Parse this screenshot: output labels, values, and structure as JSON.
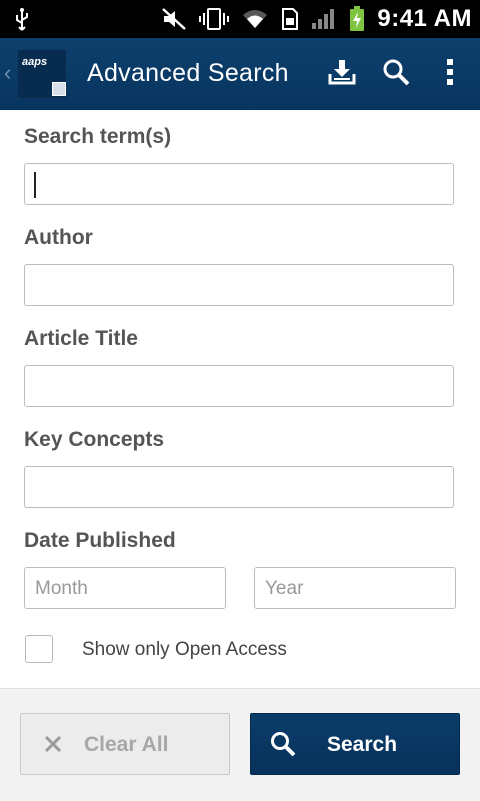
{
  "status_bar": {
    "time": "9:41 AM",
    "icons": [
      "usb-icon",
      "mute-icon",
      "vibrate-icon",
      "wifi-icon",
      "sim-icon",
      "signal-icon",
      "battery-charging-icon"
    ]
  },
  "action_bar": {
    "title": "Advanced Search",
    "logo_text": "aaps",
    "actions": [
      "download-icon",
      "search-icon",
      "overflow-menu-icon"
    ]
  },
  "form": {
    "search_terms": {
      "label": "Search term(s)",
      "value": ""
    },
    "author": {
      "label": "Author",
      "value": ""
    },
    "article_title": {
      "label": "Article Title",
      "value": ""
    },
    "key_concepts": {
      "label": "Key Concepts",
      "value": ""
    },
    "date_published": {
      "label": "Date Published",
      "month_placeholder": "Month",
      "year_placeholder": "Year"
    },
    "open_access": {
      "label": "Show only Open Access",
      "checked": false
    }
  },
  "buttons": {
    "clear_label": "Clear All",
    "search_label": "Search"
  },
  "colors": {
    "action_bar": "#0a3a66",
    "primary_button": "#083560",
    "label_text": "#555555"
  }
}
